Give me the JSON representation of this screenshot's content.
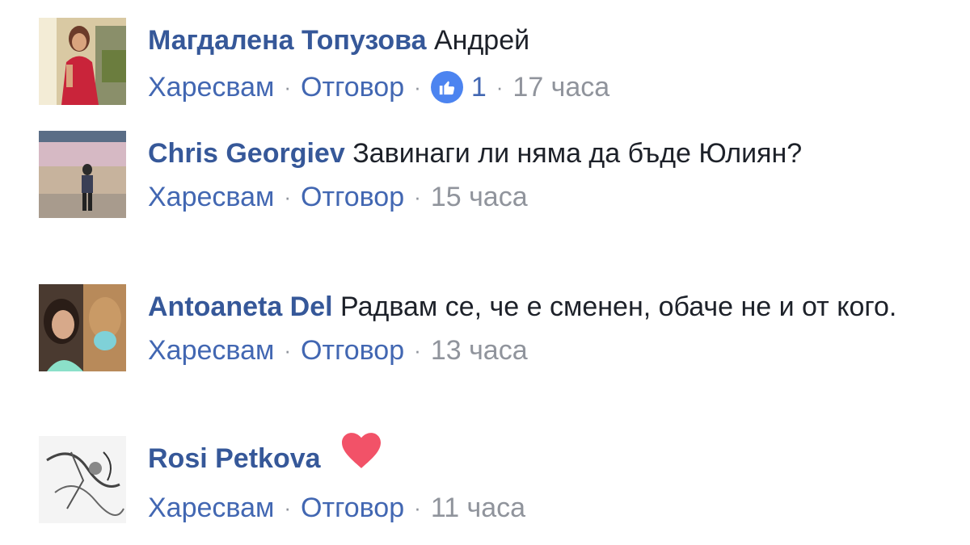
{
  "comments": [
    {
      "author": "Магдалена Топузова",
      "text": "Андрей",
      "like_label": "Харесвам",
      "reply_label": "Отговор",
      "reaction_count": "1",
      "time": "17 часа"
    },
    {
      "author": "Chris Georgiev",
      "text": "Завинаги ли няма да бъде Юлиян?",
      "like_label": "Харесвам",
      "reply_label": "Отговор",
      "time": "15 часа"
    },
    {
      "author": "Antoaneta Del",
      "text": "Радвам се, че е сменен, обаче не и от кого.",
      "like_label": "Харесвам",
      "reply_label": "Отговор",
      "time": "13 часа"
    },
    {
      "author": "Rosi Petkova",
      "text": "",
      "sticker": "heart-icon",
      "like_label": "Харесвам",
      "reply_label": "Отговор",
      "time": "11 часа"
    }
  ],
  "colors": {
    "author": "#365899",
    "link": "#4267b2",
    "meta": "#90949c",
    "text": "#1d2129",
    "like_badge": "#4c84f0",
    "heart": "#f25268"
  }
}
